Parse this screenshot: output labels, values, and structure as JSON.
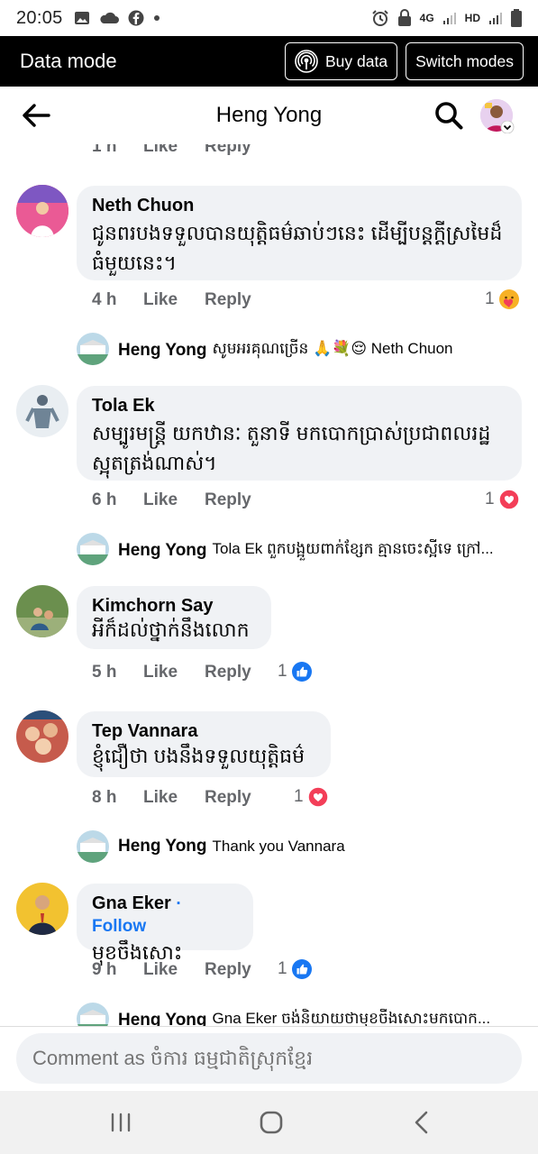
{
  "status_bar": {
    "time": "20:05",
    "network": "4G",
    "hd": "HD",
    "icons": [
      "image-icon",
      "cloud-icon",
      "facebook-icon",
      "dot-icon",
      "alarm-icon",
      "lock-icon",
      "signal-icon",
      "battery-icon"
    ]
  },
  "data_mode": {
    "title": "Data mode",
    "buy_label": "Buy data",
    "switch_label": "Switch modes"
  },
  "header": {
    "name": "Heng Yong"
  },
  "top_partial": {
    "time": "1 h",
    "like": "Like",
    "reply": "Reply"
  },
  "comments": [
    {
      "author": "Neth Chuon",
      "text": "ជូនពរបងទទួលបានយុត្តិធម៌ឆាប់ៗនេះ ដើម្បីបន្តក្តីស្រមៃដ៏ធំមួយនេះ។",
      "time": "4 h",
      "like": "Like",
      "reply": "Reply",
      "reaction_count": "1",
      "reaction": "care",
      "reply_preview": {
        "name": "Heng Yong",
        "text": "សូមអរគុណច្រើន 🙏💐😌 Neth Chuon"
      }
    },
    {
      "author": "Tola Ek",
      "text": "សម្បូរមន្ត្រី យកឋានៈ តួនាទី មកបោកប្រាស់ប្រជាពលរដ្ឋ ស្អុតត្រង់ណាស់។",
      "time": "6 h",
      "like": "Like",
      "reply": "Reply",
      "reaction_count": "1",
      "reaction": "love",
      "reply_preview": {
        "name": "Heng Yong",
        "text": "Tola Ek ពួកបង្អួយពាក់ខ្សែក គ្មានចេះស្អីទេ ក្រៅ..."
      }
    },
    {
      "author": "Kimchorn Say",
      "text": "អីក៏ដល់ថ្នាក់នឹងលោក",
      "time": "5 h",
      "like": "Like",
      "reply": "Reply",
      "reaction_count": "1",
      "reaction": "like"
    },
    {
      "author": "Tep Vannara",
      "text": "ខ្ញុំជឿថា បងនឹងទទួលយុត្តិធម៌",
      "time": "8 h",
      "like": "Like",
      "reply": "Reply",
      "reaction_count": "1",
      "reaction": "love",
      "reply_preview": {
        "name": "Heng Yong",
        "text": "Thank you Vannara"
      }
    },
    {
      "author": "Gna Eker",
      "follow": "· Follow",
      "text": "មុខចឹងសោះ",
      "time": "9 h",
      "like": "Like",
      "reply": "Reply",
      "reaction_count": "1",
      "reaction": "like",
      "reply_preview": {
        "name": "Heng Yong",
        "text": "Gna Eker ចង់និយាយថាមុខចឹងសោះមកបោក..."
      }
    }
  ],
  "comment_bar": {
    "placeholder": "Comment as ចំការ ធម្មជាតិស្រុកខ្មែរ"
  },
  "colors": {
    "accent": "#1877f2",
    "love": "#f33e58",
    "care": "#f7b125",
    "bubble": "#f0f2f5"
  }
}
